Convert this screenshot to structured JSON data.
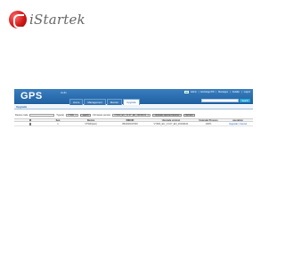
{
  "brand": {
    "name": "iStartek"
  },
  "app": {
    "logo": "GPS",
    "welcome": "Hello",
    "topbar": {
      "items": [
        "Admin",
        "Exchange PW",
        "Messages",
        "Installer",
        "Logout"
      ],
      "flag_color": "#3cae3c"
    },
    "tabs": [
      {
        "label": "Home",
        "active": false
      },
      {
        "label": "Management",
        "active": false
      },
      {
        "label": "Monitor",
        "active": false
      },
      {
        "label": "Upgrade",
        "active": true
      }
    ],
    "search": {
      "placeholder": "",
      "button_label": "Search"
    },
    "colors": {
      "banner": "#1f5f9f",
      "accent": "#27a8d8",
      "link": "#1f5fc8"
    }
  },
  "upgrade": {
    "title": "Upgrade",
    "filter": {
      "device_label": "Device code",
      "device_value": "",
      "type_label": "Type(s)",
      "type_value": "VT900",
      "search_label": "search",
      "firmware_label": "Firmware version",
      "firmware_value": "VT900_EU_V1.07_EN_20190101",
      "upgrade_selected_label": "Upgrade selected devices",
      "refresh_label": "Refresh"
    },
    "columns": [
      "",
      "Seq",
      "Device",
      "IMEI/ID",
      "Upgrade version",
      "Upgrade Process",
      "operation"
    ],
    "rows": [
      {
        "seq": "1",
        "device": "VT900(test)",
        "imei": "861092017000",
        "version": "VT900_EU_V1.07_EN_20190101",
        "process": "100%",
        "op_upgrade": "Upgrade",
        "op_cancel": "Cancel"
      }
    ]
  }
}
